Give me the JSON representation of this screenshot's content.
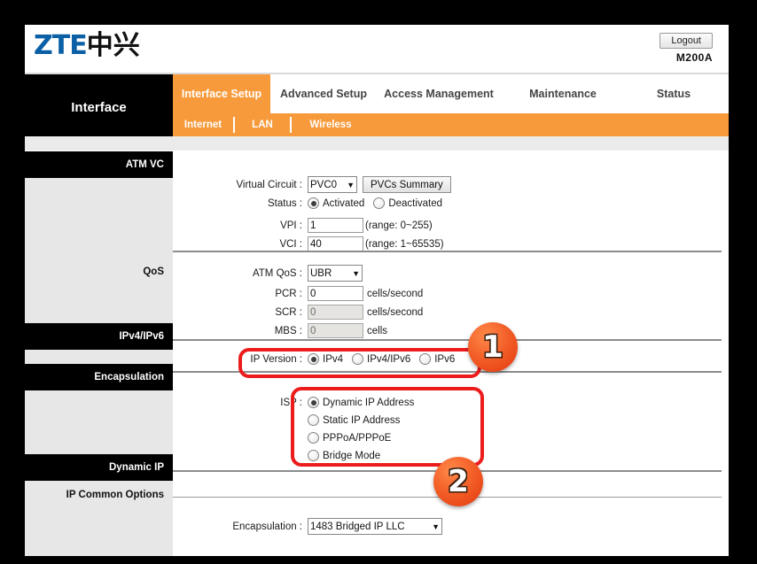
{
  "header": {
    "logo_zte": "ZTE",
    "logo_cn": "中兴",
    "logout_label": "Logout",
    "model": "M200A"
  },
  "nav": {
    "panel_label": "Interface",
    "tabs": [
      {
        "label": "Interface Setup",
        "active": true
      },
      {
        "label": "Advanced Setup",
        "active": false
      },
      {
        "label": "Access Management",
        "active": false
      },
      {
        "label": "Maintenance",
        "active": false
      },
      {
        "label": "Status",
        "active": false
      }
    ],
    "subtabs": [
      {
        "label": "Internet",
        "active": true
      },
      {
        "label": "LAN",
        "active": false
      },
      {
        "label": "Wireless",
        "active": false
      }
    ]
  },
  "sidebar": {
    "items": [
      {
        "label": "ATM VC",
        "style": "black"
      },
      {
        "label": "QoS",
        "style": "grey"
      },
      {
        "label": "IPv4/IPv6",
        "style": "black"
      },
      {
        "label": "Encapsulation",
        "style": "black"
      },
      {
        "label": "Dynamic IP",
        "style": "black"
      },
      {
        "label": "IP Common Options",
        "style": "grey"
      }
    ]
  },
  "atm_vc": {
    "virtual_circuit_label": "Virtual Circuit :",
    "virtual_circuit_value": "PVC0",
    "pvcs_summary_label": "PVCs Summary",
    "status_label": "Status :",
    "status_activated": "Activated",
    "status_deactivated": "Deactivated",
    "vpi_label": "VPI :",
    "vpi_value": "1",
    "vpi_hint": "(range: 0~255)",
    "vci_label": "VCI :",
    "vci_value": "40",
    "vci_hint": "(range: 1~65535)"
  },
  "qos": {
    "atm_qos_label": "ATM QoS :",
    "atm_qos_value": "UBR",
    "pcr_label": "PCR :",
    "pcr_value": "0",
    "pcr_unit": "cells/second",
    "scr_label": "SCR :",
    "scr_value": "0",
    "scr_unit": "cells/second",
    "mbs_label": "MBS :",
    "mbs_value": "0",
    "mbs_unit": "cells"
  },
  "ip_version": {
    "label": "IP Version :",
    "options": [
      {
        "label": "IPv4",
        "selected": true
      },
      {
        "label": "IPv4/IPv6",
        "selected": false
      },
      {
        "label": "IPv6",
        "selected": false
      }
    ]
  },
  "isp": {
    "label": "ISP :",
    "options": [
      {
        "label": "Dynamic IP Address",
        "selected": true
      },
      {
        "label": "Static IP Address",
        "selected": false
      },
      {
        "label": "PPPoA/PPPoE",
        "selected": false
      },
      {
        "label": "Bridge Mode",
        "selected": false
      }
    ]
  },
  "encapsulation": {
    "label": "Encapsulation :",
    "value": "1483 Bridged IP LLC"
  },
  "annotations": {
    "badge1": "1",
    "badge2": "2",
    "highlight_color": "#ec1c1c"
  },
  "select_arrow": "▼"
}
